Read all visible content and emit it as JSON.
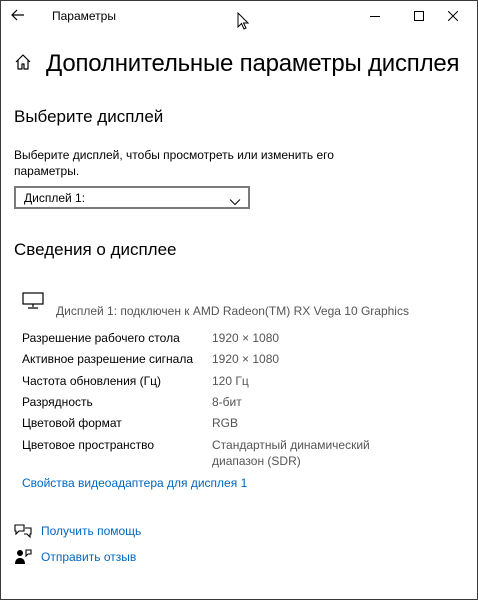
{
  "window": {
    "title": "Параметры"
  },
  "page": {
    "title": "Дополнительные параметры дисплея"
  },
  "select_display": {
    "heading": "Выберите дисплей",
    "description": "Выберите дисплей, чтобы просмотреть или изменить его параметры.",
    "selected": "Дисплей 1:"
  },
  "display_info": {
    "heading": "Сведения о дисплее",
    "connected": "Дисплей 1: подключен к AMD Radeon(TM) RX Vega 10 Graphics",
    "rows": [
      {
        "label": "Разрешение рабочего стола",
        "value": "1920 × 1080"
      },
      {
        "label": "Активное разрешение сигнала",
        "value": "1920 × 1080"
      },
      {
        "label": "Частота обновления (Гц)",
        "value": "120 Гц"
      },
      {
        "label": "Разрядность",
        "value": "8-бит"
      },
      {
        "label": "Цветовой формат",
        "value": "RGB"
      },
      {
        "label": "Цветовое пространство",
        "value": "Стандартный динамический диапазон (SDR)"
      }
    ],
    "adapter_link": "Свойства видеоадаптера для дисплея 1"
  },
  "footer": {
    "help": "Получить помощь",
    "feedback": "Отправить отзыв"
  },
  "colors": {
    "accent": "#0067c0",
    "secondary_text": "#555555"
  }
}
